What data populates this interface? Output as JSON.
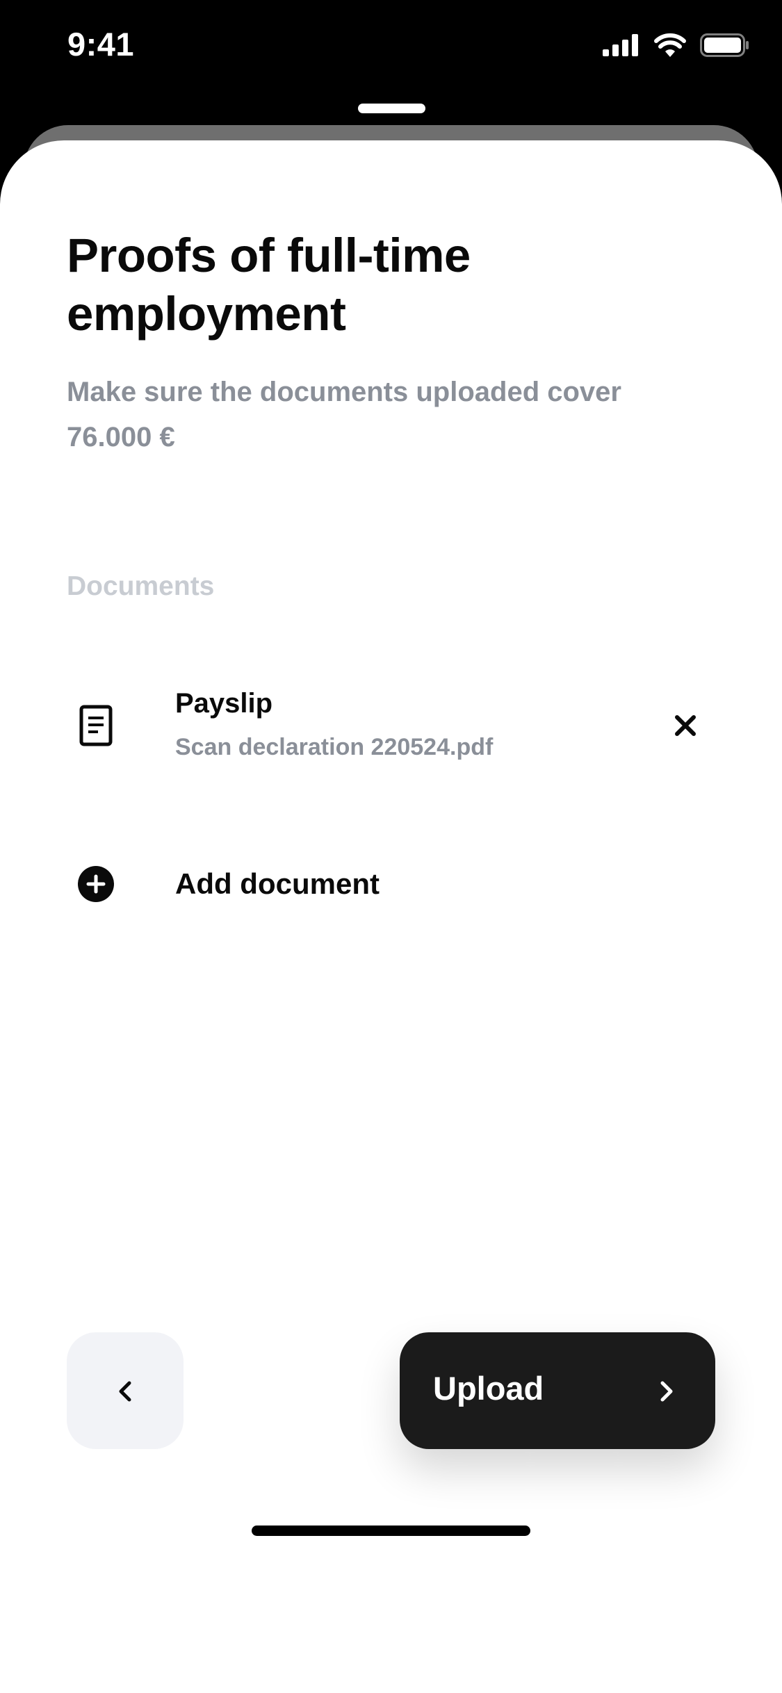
{
  "status_bar": {
    "time": "9:41",
    "icons": [
      "cellular-signal-icon",
      "wifi-icon",
      "battery-icon"
    ]
  },
  "sheet": {
    "title": "Proofs of full-time employment",
    "subtitle": "Make sure the documents uploaded cover 76.000 €"
  },
  "documents": {
    "section_label": "Documents",
    "items": [
      {
        "name": "Payslip",
        "file": "Scan declaration 220524.pdf",
        "icon": "document-icon",
        "action_icon": "close-icon"
      }
    ],
    "add_label": "Add document",
    "add_icon": "plus-circle-icon"
  },
  "footer": {
    "back_icon": "chevron-left-icon",
    "upload_label": "Upload",
    "upload_icon": "chevron-right-icon"
  },
  "colors": {
    "primary_text": "#0a0a0a",
    "secondary_text": "#8a8f98",
    "section_label": "#c8ccd2",
    "primary_button": "#1b1b1b",
    "secondary_button": "#f2f3f7"
  }
}
